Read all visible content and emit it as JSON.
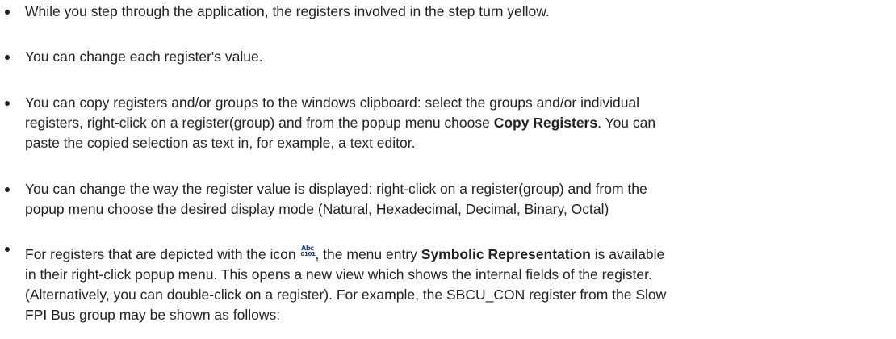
{
  "bullets": [
    {
      "lines": [
        "While you step through the application, the registers involved in the step turn yellow."
      ]
    },
    {
      "lines": [
        "You can change each register's value."
      ]
    },
    {
      "line1": "You can copy registers and/or groups to the windows clipboard: select the groups and/or individual",
      "line2_pre": "registers, right-click on a register(group) and from the popup menu choose ",
      "line2_bold": "Copy Registers",
      "line2_post": ". You can",
      "line3": "paste the copied selection as text in, for example, a text editor."
    },
    {
      "line1": "You can change the way the register value is displayed: right-click on a register(group) and from the",
      "line2": "popup menu choose the desired display mode (Natural, Hexadecimal, Decimal, Binary, Octal)"
    },
    {
      "line1_pre": "For registers that are depicted with the icon ",
      "icon_top": "Abc",
      "icon_bottom": "0101",
      "icon_name": "symbolic-register-icon",
      "line1_mid": ", the menu entry ",
      "line1_bold": "Symbolic Representation",
      "line1_post": " is available",
      "line2": "in their right-click popup menu. This opens a new view which shows the internal fields of the register.",
      "line3": "(Alternatively, you can double-click on a register). For example, the SBCU_CON register from the Slow",
      "line4": "FPI Bus group may be shown as follows:"
    }
  ]
}
